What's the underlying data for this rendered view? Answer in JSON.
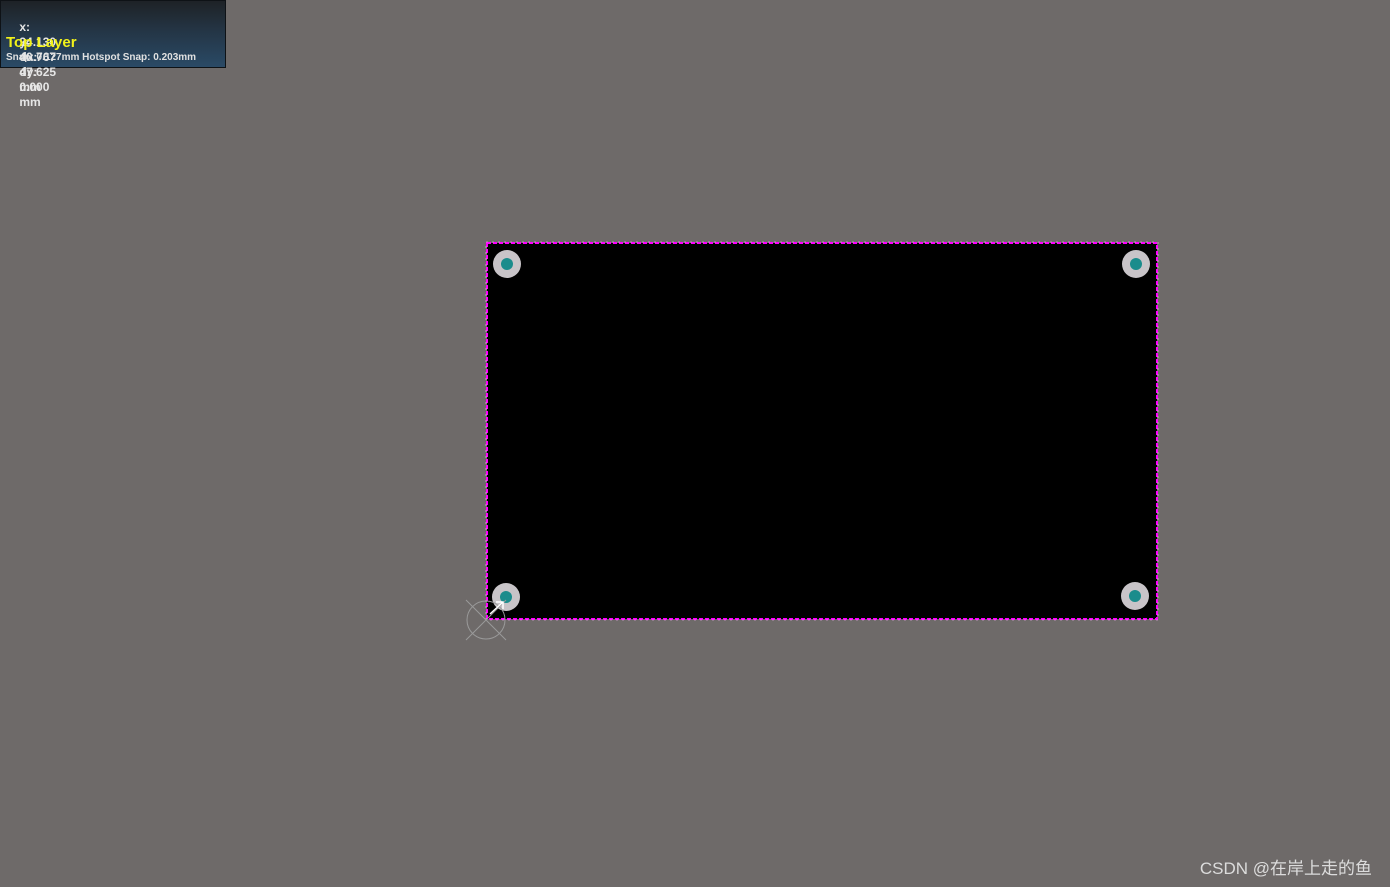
{
  "hud": {
    "x_label": "x:",
    "x_value": "24.130",
    "dx_label": "dx:",
    "dx_value": "47.625",
    "x_unit": "mm",
    "y_label": "y:",
    "y_value": "40.767",
    "dy_label": "dy:",
    "dy_value": "0.000",
    "y_unit": "mm",
    "layer": "Top Layer",
    "snap": "Snap: 0.127mm Hotspot Snap: 0.203mm"
  },
  "board": {
    "fill_color": "#000000",
    "outline_color": "#ff00ff",
    "pad_outer_color": "#c8c4c8",
    "pad_inner_color": "#1a8c8c",
    "pads": [
      "top-left",
      "top-right",
      "bottom-left",
      "bottom-right"
    ]
  },
  "background_color": "#6e6a69",
  "watermark": "CSDN @在岸上走的鱼"
}
